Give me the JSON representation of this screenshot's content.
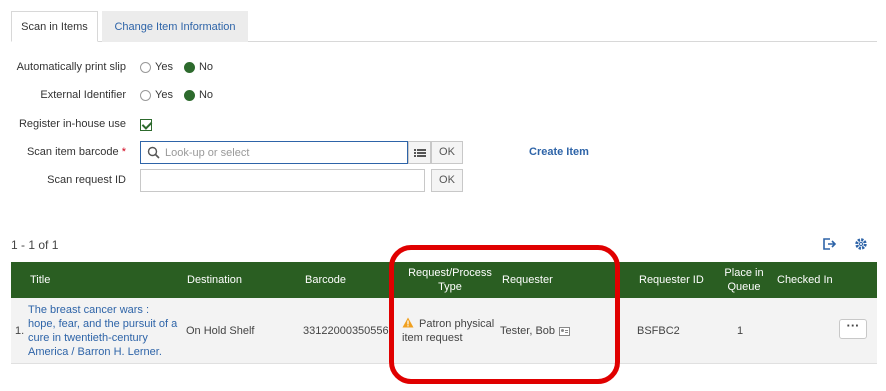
{
  "tabs": [
    {
      "label": "Scan in Items",
      "active": true
    },
    {
      "label": "Change Item Information",
      "active": false
    }
  ],
  "form": {
    "auto_print": {
      "label": "Automatically print slip",
      "options": [
        "Yes",
        "No"
      ],
      "selected": "No"
    },
    "external_id": {
      "label": "External Identifier",
      "options": [
        "Yes",
        "No"
      ],
      "selected": "No"
    },
    "inhouse": {
      "label": "Register in-house use",
      "checked": true
    },
    "barcode": {
      "label": "Scan item barcode",
      "required_mark": "*",
      "placeholder": "Look-up or select",
      "value": "",
      "ok": "OK"
    },
    "request_id": {
      "label": "Scan request ID",
      "value": "",
      "ok": "OK"
    },
    "create_item": "Create Item"
  },
  "results": {
    "count": "1 - 1 of 1",
    "columns": [
      "Title",
      "Destination",
      "Barcode",
      "Request/Process Type",
      "Requester",
      "Requester ID",
      "Place in Queue",
      "Checked In"
    ],
    "rows": [
      {
        "index": "1.",
        "title": "The breast cancer wars : hope, fear, and the pursuit of a cure in twentieth-century America / Barron H. Lerner.",
        "destination": "On Hold Shelf",
        "barcode": "33122000350556",
        "request_type": "Patron physical item request",
        "requester": "Tester, Bob",
        "requester_id": "BSFBC2",
        "place_in_queue": "1",
        "checked_in": "",
        "actions": "···"
      }
    ]
  },
  "colors": {
    "header_bg": "#2a5e22",
    "link": "#2e64a8",
    "highlight": "#e00000",
    "radio_on": "#2d6a2d"
  }
}
